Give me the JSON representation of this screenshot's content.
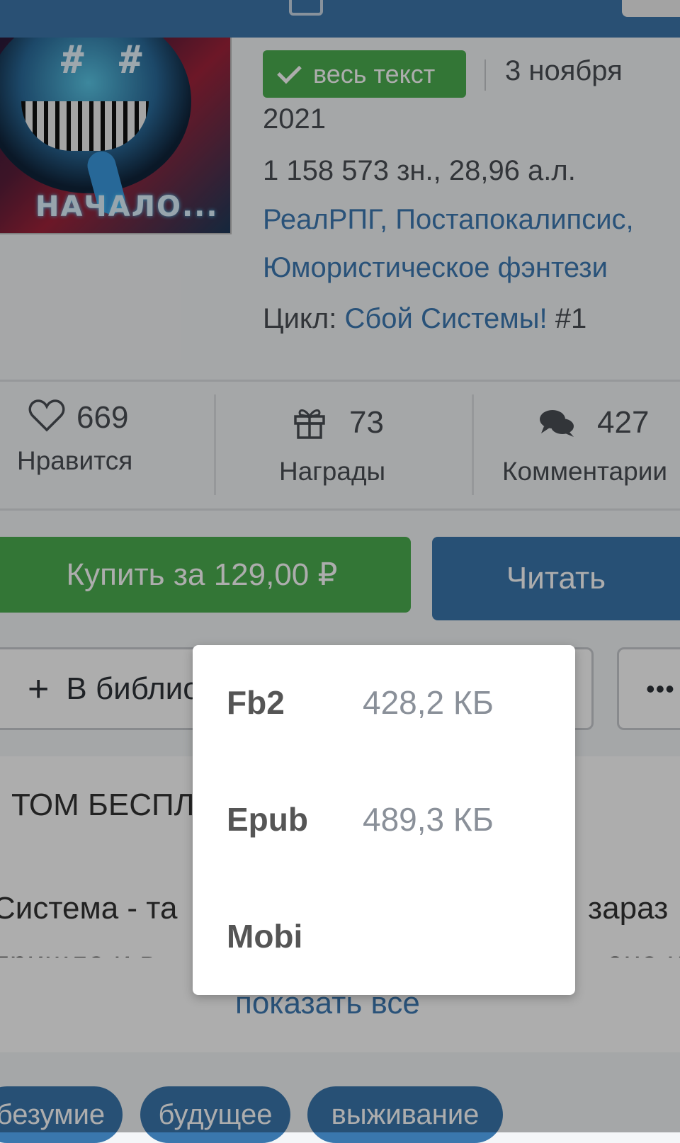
{
  "book": {
    "cover_title": "НАЧАЛО...",
    "badge": "весь текст",
    "date_part1": "3 ноября",
    "date_part2": "2021",
    "size": "1 158 573 зн., 28,96 а.л.",
    "genres": [
      "РеалРПГ",
      "Постапокалипсис",
      "Юмористическое фэнтези"
    ],
    "genre_sep": ", ",
    "cycle_label": "Цикл: ",
    "cycle_name": "Сбой Системы!",
    "cycle_num": " #1"
  },
  "stats": {
    "likes": {
      "icon": "heart-icon",
      "count": "669",
      "label": "Нравится"
    },
    "awards": {
      "icon": "gift-icon",
      "count": "73",
      "label": "Награды"
    },
    "comments": {
      "icon": "comments-icon",
      "count": "427",
      "label": "Комментарии"
    }
  },
  "actions": {
    "buy": "Купить за 129,00 ₽",
    "read": "Читать",
    "library": "В библиотеку",
    "more_icon": "more-dots-icon"
  },
  "annotation": {
    "title": "ТОМ БЕСПЛАТНО",
    "line1_start": "Система - та",
    "line1_end": "зараз",
    "line2_start": "пришла и в",
    "line2_end": "она н",
    "show_all": "показать все"
  },
  "tags": [
    "безумие",
    "будущее",
    "выживание"
  ],
  "download_menu": {
    "formats": [
      {
        "name": "Fb2",
        "size": "428,2 КБ"
      },
      {
        "name": "Epub",
        "size": "489,3 КБ"
      },
      {
        "name": "Mobi",
        "size": ""
      }
    ]
  },
  "colors": {
    "brand_blue": "#3a77ad",
    "green": "#4caf50",
    "link": "#3d7ab3"
  }
}
